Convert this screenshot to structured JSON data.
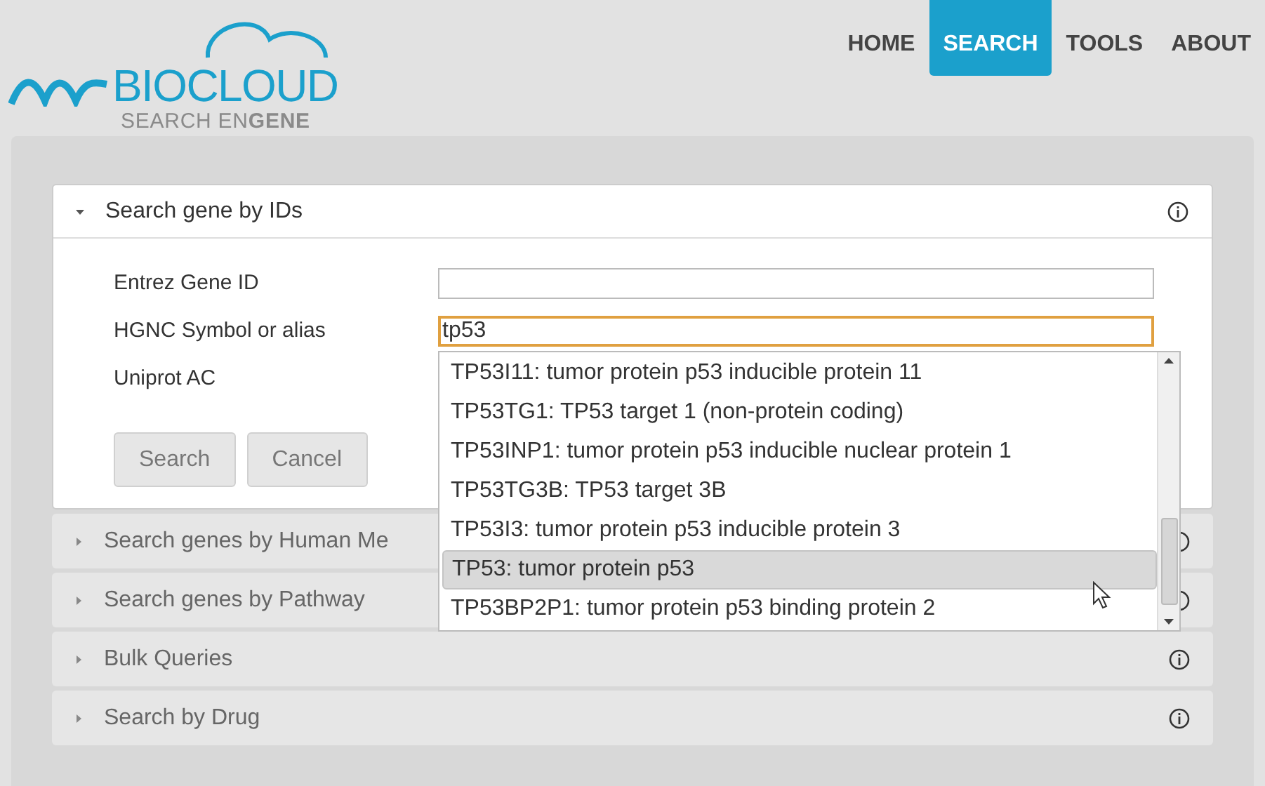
{
  "logo": {
    "name": "BIOCLOUD",
    "tagline": "SEARCH EN**GENE**"
  },
  "nav": [
    {
      "label": "HOME",
      "selected": false
    },
    {
      "label": "SEARCH",
      "selected": true
    },
    {
      "label": "TOOLS",
      "selected": false
    },
    {
      "label": "ABOUT",
      "selected": false
    }
  ],
  "panels": [
    {
      "title": "Search gene by IDs",
      "expanded": true
    },
    {
      "title": "Search genes by Human Me",
      "expanded": false
    },
    {
      "title": "Search genes by Pathway",
      "expanded": false
    },
    {
      "title": "Bulk Queries",
      "expanded": false
    },
    {
      "title": "Search by Drug",
      "expanded": false
    }
  ],
  "form": {
    "fields": [
      {
        "label": "Entrez Gene ID",
        "focused": false
      },
      {
        "label": "HGNC Symbol or alias",
        "value": "tp53",
        "focused": true
      },
      {
        "label": "Uniprot AC"
      }
    ],
    "buttons": [
      "Search",
      "Cancel"
    ]
  },
  "suggestions": [
    {
      "text": "TP53I11: tumor protein p53 inducible protein 11",
      "selected": false
    },
    {
      "text": "TP53TG1: TP53 target 1 (non-protein coding)",
      "selected": false
    },
    {
      "text": "TP53INP1: tumor protein p53 inducible nuclear protein 1",
      "selected": false
    },
    {
      "text": "TP53TG3B: TP53 target 3B",
      "selected": false
    },
    {
      "text": "TP53I3: tumor protein p53 inducible protein 3",
      "selected": false
    },
    {
      "text": "TP53: tumor protein p53",
      "selected": true
    },
    {
      "text": "TP53BP2P1: tumor protein p53 binding protein  2",
      "selected": false
    }
  ]
}
